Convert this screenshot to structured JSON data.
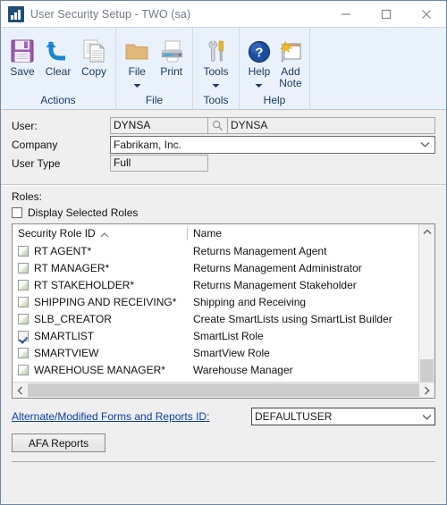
{
  "window": {
    "title": "User Security Setup",
    "title_separator": "-",
    "title_context": "TWO (sa)",
    "app_icon": "chart-bars-icon",
    "controls": {
      "minimize": "minimize-icon",
      "maximize": "maximize-icon",
      "close": "close-icon"
    }
  },
  "ribbon": {
    "groups": [
      {
        "label": "Actions",
        "items": [
          {
            "label": "Save",
            "icon": "floppy-save-icon",
            "dropdown": false
          },
          {
            "label": "Clear",
            "icon": "undo-arrow-icon",
            "dropdown": false
          },
          {
            "label": "Copy",
            "icon": "copy-pages-icon",
            "dropdown": false
          }
        ]
      },
      {
        "label": "File",
        "items": [
          {
            "label": "File",
            "icon": "folder-icon",
            "dropdown": true
          },
          {
            "label": "Print",
            "icon": "printer-icon",
            "dropdown": false
          }
        ]
      },
      {
        "label": "Tools",
        "items": [
          {
            "label": "Tools",
            "icon": "wrench-screwdriver-icon",
            "dropdown": true
          }
        ]
      },
      {
        "label": "Help",
        "items": [
          {
            "label": "Help",
            "icon": "help-question-icon",
            "dropdown": true
          },
          {
            "label": "Add",
            "label2": "Note",
            "icon": "add-note-icon",
            "dropdown": false
          }
        ]
      }
    ]
  },
  "form": {
    "user": {
      "label": "User:",
      "id_value": "DYNSA",
      "lookup_icon": "magnifier-lookup-icon",
      "name_value": "DYNSA"
    },
    "company": {
      "label": "Company",
      "value": "Fabrikam, Inc.",
      "dropdown_icon": "chevron-down-icon"
    },
    "user_type": {
      "label": "User Type",
      "value": "Full"
    }
  },
  "roles": {
    "section_label": "Roles:",
    "display_selected": {
      "label": "Display Selected Roles",
      "checked": false
    },
    "columns": [
      "Security Role ID",
      "Name"
    ],
    "sort": {
      "column": "Security Role ID",
      "direction": "ascending",
      "icon": "caret-up-icon"
    },
    "rows": [
      {
        "checked": false,
        "id": "RT AGENT*",
        "name": "Returns Management Agent"
      },
      {
        "checked": false,
        "id": "RT MANAGER*",
        "name": "Returns Management Administrator"
      },
      {
        "checked": false,
        "id": "RT STAKEHOLDER*",
        "name": "Returns Management Stakeholder"
      },
      {
        "checked": false,
        "id": "SHIPPING AND RECEIVING*",
        "name": "Shipping and Receiving"
      },
      {
        "checked": false,
        "id": "SLB_CREATOR",
        "name": "Create SmartLists using SmartList Builder"
      },
      {
        "checked": true,
        "id": "SMARTLIST",
        "name": "SmartList Role"
      },
      {
        "checked": false,
        "id": "SMARTVIEW",
        "name": "SmartView Role"
      },
      {
        "checked": false,
        "id": "WAREHOUSE MANAGER*",
        "name": "Warehouse Manager"
      }
    ],
    "scroll": {
      "up_icon": "chevron-up-icon",
      "down_icon": "chevron-down-icon",
      "left_icon": "chevron-left-icon",
      "right_icon": "chevron-right-icon"
    }
  },
  "bottom": {
    "alternate_link": "Alternate/Modified Forms and Reports ID:",
    "alternate_value": "DEFAULTUSER",
    "alternate_dropdown_icon": "chevron-down-icon",
    "afa_reports_button": "AFA Reports"
  },
  "colors": {
    "window_border": "#6b87a3",
    "ribbon_bg": "#e9f2fb",
    "ribbon_text": "#1b3a63",
    "link": "#0b3fa8",
    "check_blue": "#2c5aa0",
    "body_bg": "#efefef"
  }
}
